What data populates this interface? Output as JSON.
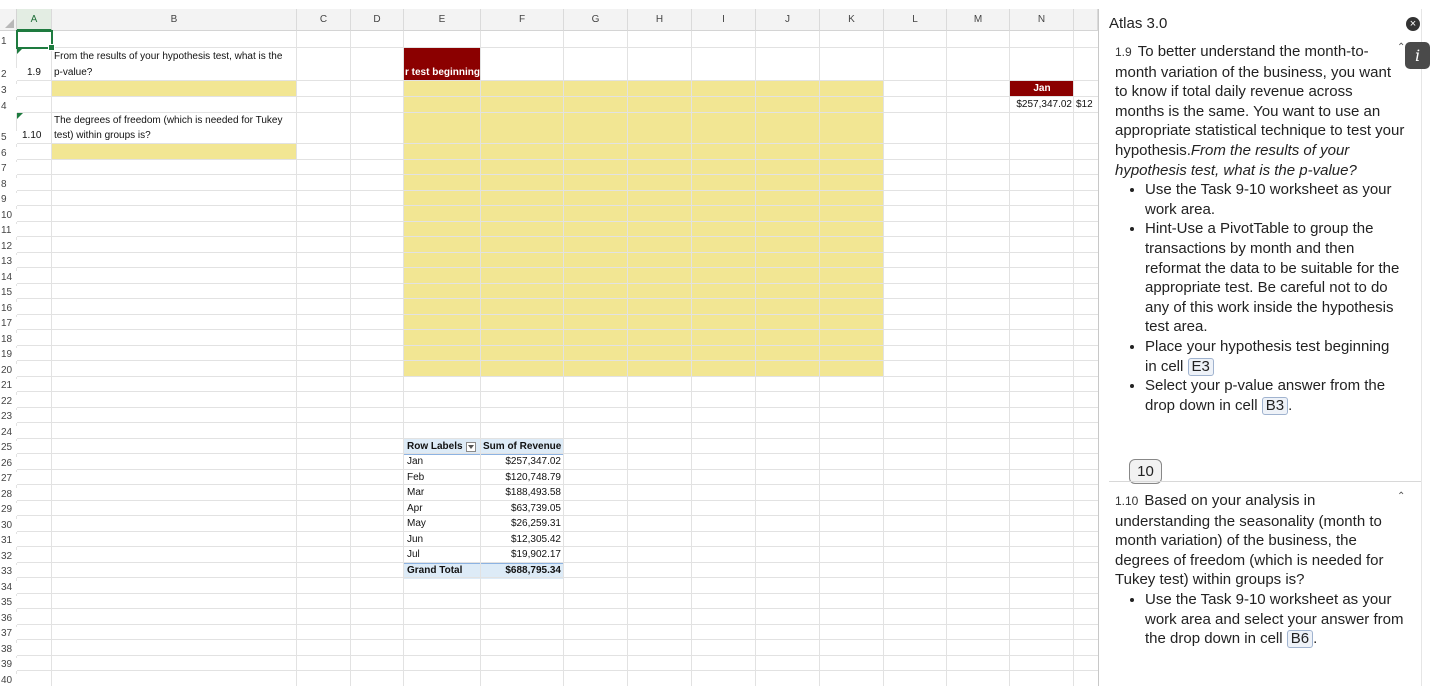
{
  "columns": [
    "A",
    "B",
    "C",
    "D",
    "E",
    "F",
    "G",
    "H",
    "I",
    "J",
    "K",
    "L",
    "M",
    "N"
  ],
  "rows": [
    "1",
    "2",
    "3",
    "4",
    "5",
    "6",
    "7",
    "8",
    "9",
    "10",
    "11",
    "12",
    "13",
    "14",
    "15",
    "16",
    "17",
    "18",
    "19",
    "20",
    "21",
    "22",
    "23",
    "24",
    "25",
    "26",
    "27",
    "28",
    "29",
    "30",
    "31",
    "32",
    "33",
    "34",
    "35",
    "36",
    "37",
    "38",
    "39",
    "40"
  ],
  "cells": {
    "a2": "1.9",
    "b2_line1": "From the results of your hypothesis test, what is the",
    "b2_line2": "p-value?",
    "a5": "1.10",
    "b5_line1": "The degrees of freedom (which is needed for Tukey",
    "b5_line2": "test) within groups is?",
    "e2": "r test beginning",
    "n3": "Jan",
    "n4": "$257,347.02",
    "o4": "$12"
  },
  "pivot": {
    "header_labels": "Row Labels",
    "header_sum": "Sum of Revenue",
    "rows": [
      {
        "label": "Jan",
        "value": "$257,347.02"
      },
      {
        "label": "Feb",
        "value": "$120,748.79"
      },
      {
        "label": "Mar",
        "value": "$188,493.58"
      },
      {
        "label": "Apr",
        "value": "$63,739.05"
      },
      {
        "label": "May",
        "value": "$26,259.31"
      },
      {
        "label": "Jun",
        "value": "$12,305.42"
      },
      {
        "label": "Jul",
        "value": "$19,902.17"
      }
    ],
    "total_label": "Grand Total",
    "total_value": "$688,795.34"
  },
  "colors": {
    "yellow": "#f2e693",
    "darkred": "#8b0000",
    "pivot_blue": "#ddebf7",
    "green": "#1e7b3f"
  },
  "panel": {
    "title": "Atlas 3.0",
    "close_icon": "×",
    "info_icon": "i",
    "q1": {
      "num": "1.9",
      "text": "To better understand the month-to-month variation of the business, you want to know if total daily revenue across months is the same. You want to use an appropriate statistical technique to test your hypothesis.",
      "italic": "From the results of your hypothesis test, what is the p-value?",
      "bullet1": "Use the Task 9-10 worksheet as your work area.",
      "bullet2": "Hint-Use a PivotTable to group the transactions by month and then reformat the data to be suitable for the appropriate test. Be careful not to do any of this work inside the hypothesis test area.",
      "bullet3_pre": "Place your hypothesis test beginning in cell",
      "bullet3_ref": "E3",
      "bullet4_pre": "Select your p-value answer from the drop down in cell",
      "bullet4_ref": "B3",
      "bullet4_post": "."
    },
    "badge": "10",
    "q2": {
      "num": "1.10",
      "text": "Based on your analysis in understanding the seasonality (month to month variation) of the business, the degrees of freedom (which is needed for Tukey test) within groups is?",
      "bullet1_pre": "Use the Task 9-10 worksheet as your work area and select your answer from the drop down in cell",
      "bullet1_ref": "B6",
      "bullet1_post": "."
    }
  }
}
